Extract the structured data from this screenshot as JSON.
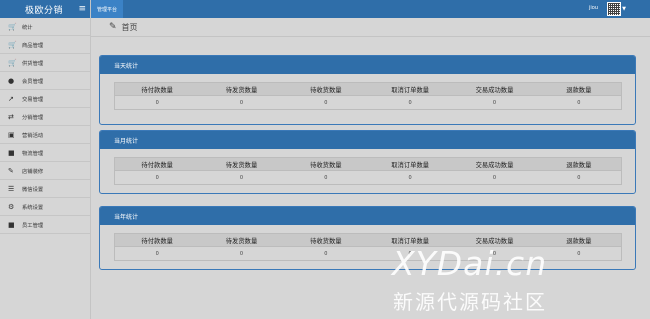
{
  "app": {
    "brand": "极欧分销",
    "platform_tab": "管理平台",
    "user": "jiou"
  },
  "sidebar": {
    "items": [
      {
        "icon": "cart-icon",
        "label": "统计"
      },
      {
        "icon": "cart-icon",
        "label": "商品管理"
      },
      {
        "icon": "cart-icon",
        "label": "供货管理"
      },
      {
        "icon": "user-icon",
        "label": "会员管理"
      },
      {
        "icon": "compress-icon",
        "label": "交易管理"
      },
      {
        "icon": "shuffle-icon",
        "label": "分销管理"
      },
      {
        "icon": "gift-icon",
        "label": "营销活动"
      },
      {
        "icon": "truck-icon",
        "label": "物流管理"
      },
      {
        "icon": "wrench-icon",
        "label": "店铺装修"
      },
      {
        "icon": "list-icon",
        "label": "微信设置"
      },
      {
        "icon": "gear-icon",
        "label": "系统设置"
      },
      {
        "icon": "user-group-icon",
        "label": "员工管理"
      }
    ]
  },
  "breadcrumb": {
    "title": "首页"
  },
  "panels": [
    {
      "title": "当天统计",
      "headers": [
        "待付款数量",
        "待发货数量",
        "待收货数量",
        "取消订单数量",
        "交易成功数量",
        "退款数量"
      ],
      "values": [
        "0",
        "0",
        "0",
        "0",
        "0",
        "0"
      ]
    },
    {
      "title": "当月统计",
      "headers": [
        "待付款数量",
        "待发货数量",
        "待收货数量",
        "取消订单数量",
        "交易成功数量",
        "退款数量"
      ],
      "values": [
        "0",
        "0",
        "0",
        "0",
        "0",
        "0"
      ]
    },
    {
      "title": "当年统计",
      "headers": [
        "待付款数量",
        "待发货数量",
        "待收货数量",
        "取消订单数量",
        "交易成功数量",
        "退款数量"
      ],
      "values": [
        "0",
        "0",
        "0",
        "0",
        "0",
        "0"
      ]
    }
  ],
  "watermark": {
    "line1": "XYDai.cn",
    "line2": "新源代源码社区"
  },
  "colors": {
    "primary": "#2f6ea9",
    "background": "#d6d6d6"
  }
}
